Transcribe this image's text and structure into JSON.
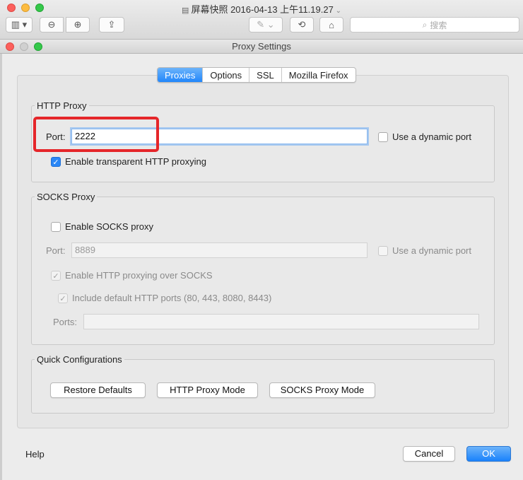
{
  "outer_window": {
    "title": "屏幕快照 2016-04-13 上午11.19.27",
    "search_placeholder": "搜索"
  },
  "dialog": {
    "title": "Proxy Settings",
    "tabs": [
      {
        "label": "Proxies",
        "active": true
      },
      {
        "label": "Options",
        "active": false
      },
      {
        "label": "SSL",
        "active": false
      },
      {
        "label": "Mozilla Firefox",
        "active": false
      }
    ],
    "http_proxy": {
      "legend": "HTTP Proxy",
      "port_label": "Port:",
      "port_value": "2222",
      "dynamic_port_label": "Use a dynamic port",
      "dynamic_port_checked": false,
      "transparent_label": "Enable transparent HTTP proxying",
      "transparent_checked": true
    },
    "socks_proxy": {
      "legend": "SOCKS Proxy",
      "enable_label": "Enable SOCKS proxy",
      "enable_checked": false,
      "port_label": "Port:",
      "port_value": "8889",
      "dynamic_port_label": "Use a dynamic port",
      "http_over_socks_label": "Enable HTTP proxying over SOCKS",
      "include_default_label": "Include default HTTP ports (80, 443, 8080, 8443)",
      "ports_label": "Ports:",
      "ports_value": ""
    },
    "quick_config": {
      "legend": "Quick Configurations",
      "restore_label": "Restore Defaults",
      "http_mode_label": "HTTP Proxy Mode",
      "socks_mode_label": "SOCKS Proxy Mode"
    },
    "footer": {
      "help_label": "Help",
      "cancel_label": "Cancel",
      "ok_label": "OK"
    }
  },
  "colors": {
    "accent": "#1a82fb",
    "annotation": "#e5262a"
  }
}
